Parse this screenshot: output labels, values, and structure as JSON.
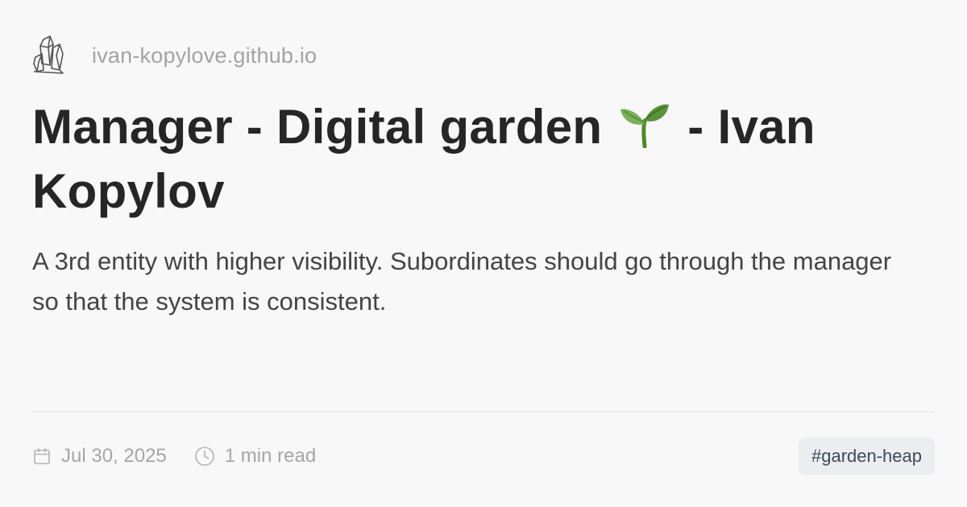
{
  "site": {
    "logo_icon": "crystal-cluster-icon",
    "url": "ivan-kopylove.github.io"
  },
  "post": {
    "title_part1": "Manager - Digital garden",
    "title_emoji_icon": "seedling-icon",
    "title_part2": "- Ivan Kopylov",
    "description": "A 3rd entity with higher visibility. Subordinates should go through the manager so that the system is consistent.",
    "date": "Jul 30, 2025",
    "date_icon": "calendar-icon",
    "read_time": "1 min read",
    "read_time_icon": "clock-icon",
    "tag": "#garden-heap"
  },
  "colors": {
    "background": "#f9f8f9",
    "title": "#262626",
    "muted": "#a6a6a6",
    "tag_bg": "#ebedf0",
    "tag_text": "#3f4a5a",
    "sprout_green": "#6aa84f"
  }
}
